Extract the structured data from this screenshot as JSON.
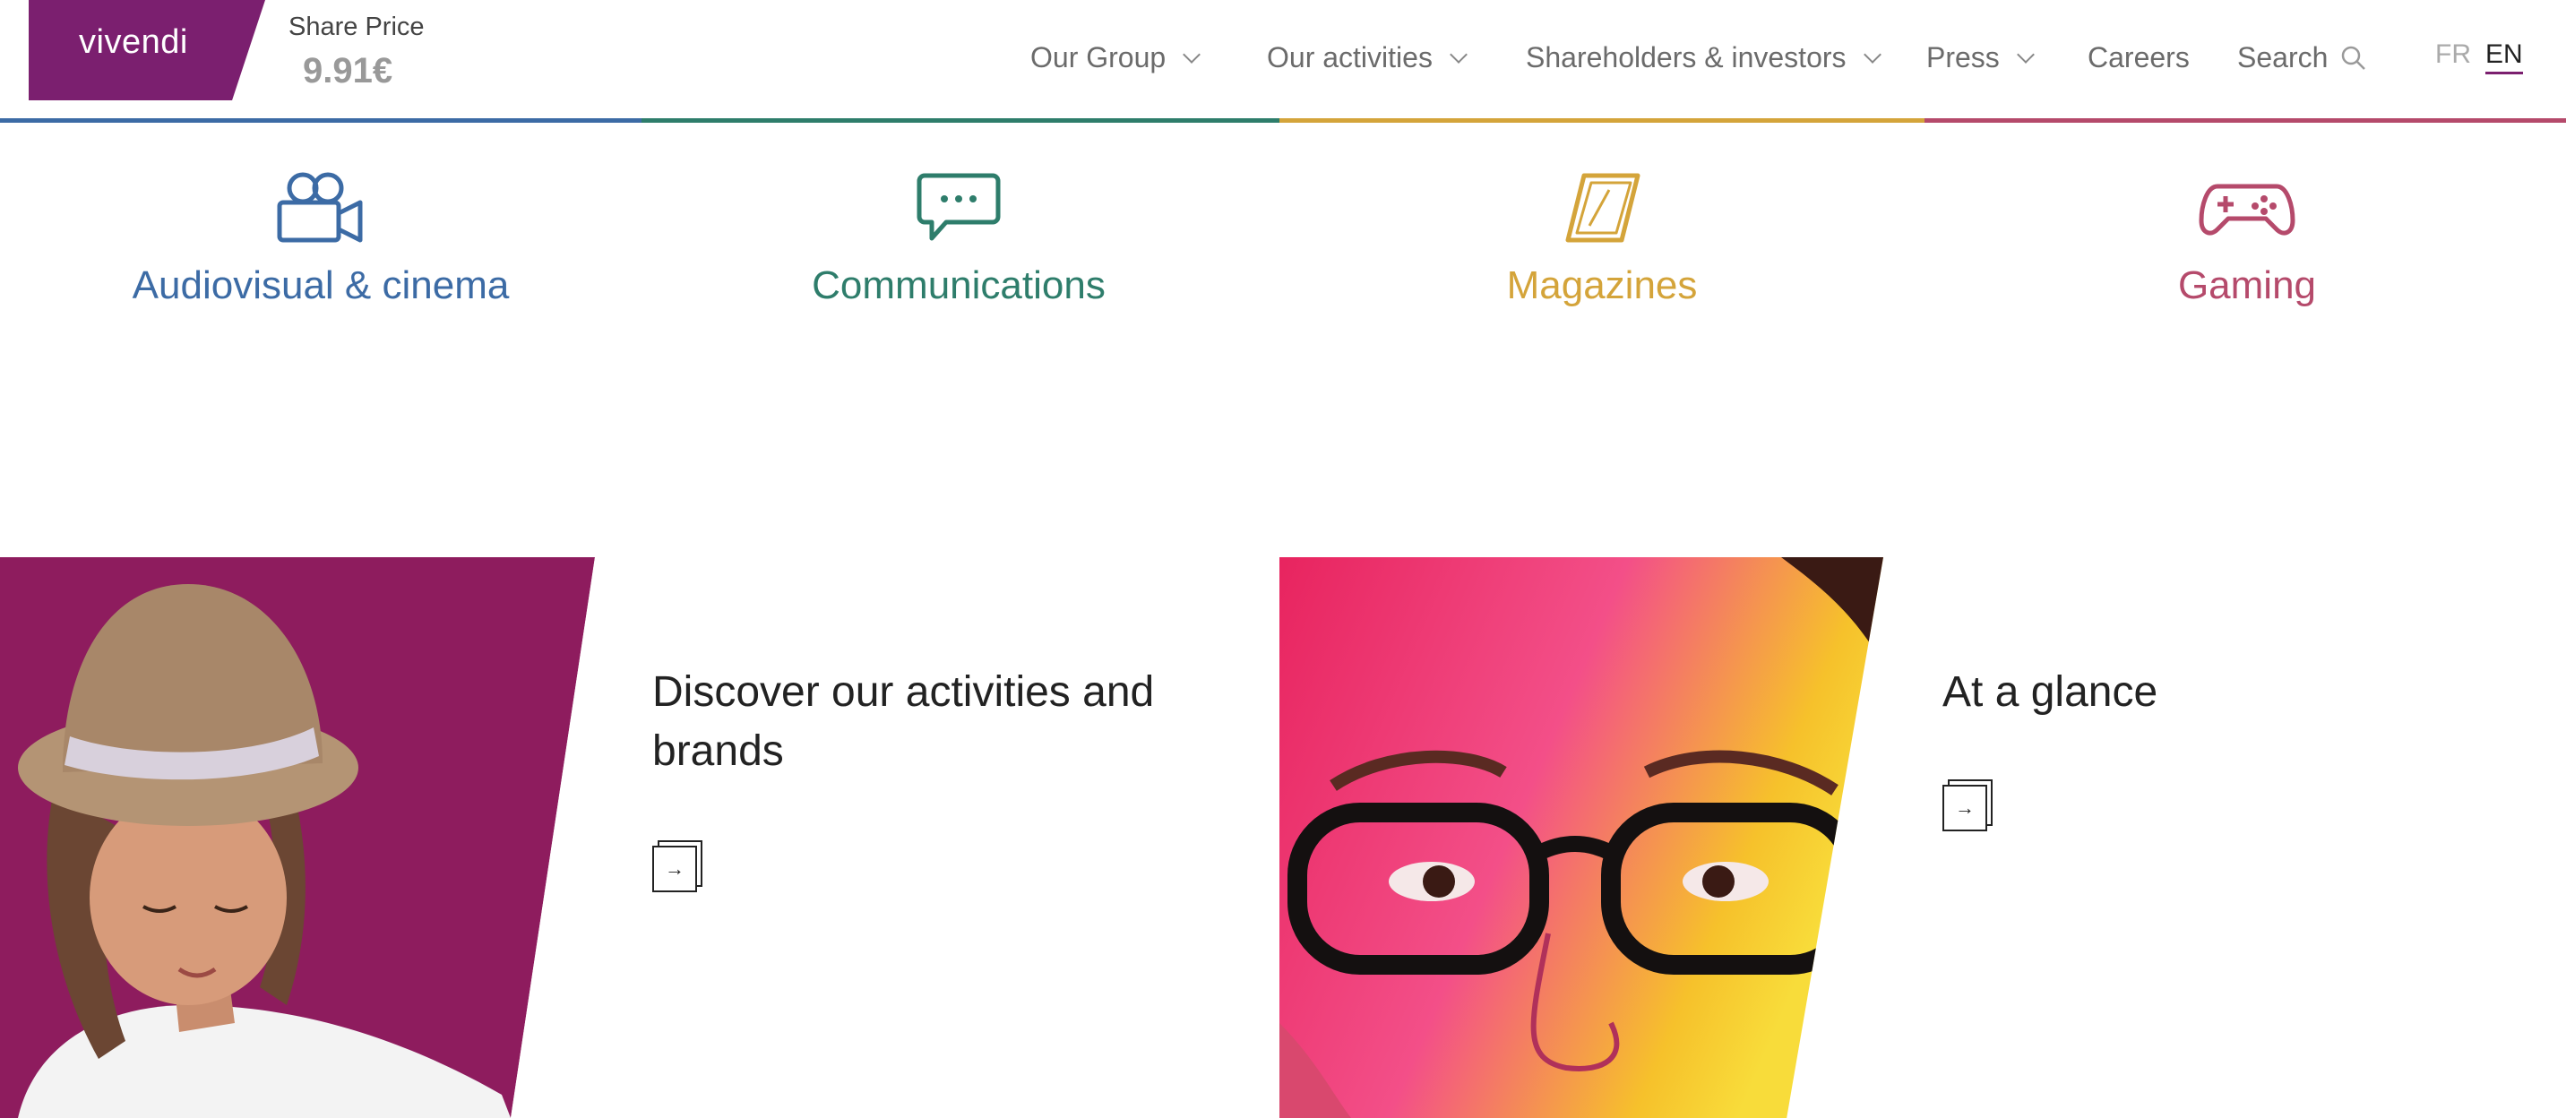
{
  "header": {
    "logo_text": "vivendi",
    "share_price_label": "Share Price",
    "share_price_value": "9.91€"
  },
  "nav": {
    "items": [
      {
        "label": "Our Group",
        "has_dropdown": true
      },
      {
        "label": "Our activities",
        "has_dropdown": true
      },
      {
        "label": "Shareholders & investors",
        "has_dropdown": true
      },
      {
        "label": "Press",
        "has_dropdown": true
      },
      {
        "label": "Careers",
        "has_dropdown": false
      }
    ],
    "search_label": "Search",
    "languages": [
      {
        "code": "FR",
        "active": false
      },
      {
        "code": "EN",
        "active": true
      }
    ]
  },
  "colors": {
    "brand": "#7b1f6f",
    "audiovisual": "#3c6ba5",
    "communications": "#2e7d6b",
    "magazines": "#d4a43a",
    "gaming": "#b54a6b"
  },
  "activities": [
    {
      "label": "Audiovisual & cinema",
      "icon": "video-camera-icon"
    },
    {
      "label": "Communications",
      "icon": "chat-bubble-icon"
    },
    {
      "label": "Magazines",
      "icon": "magazine-icon"
    },
    {
      "label": "Gaming",
      "icon": "gamepad-icon"
    }
  ],
  "cards": [
    {
      "title": "Discover our activities and brands",
      "button_icon": "arrow-right-icon"
    },
    {
      "title": "At a glance",
      "button_icon": "arrow-right-icon"
    }
  ]
}
